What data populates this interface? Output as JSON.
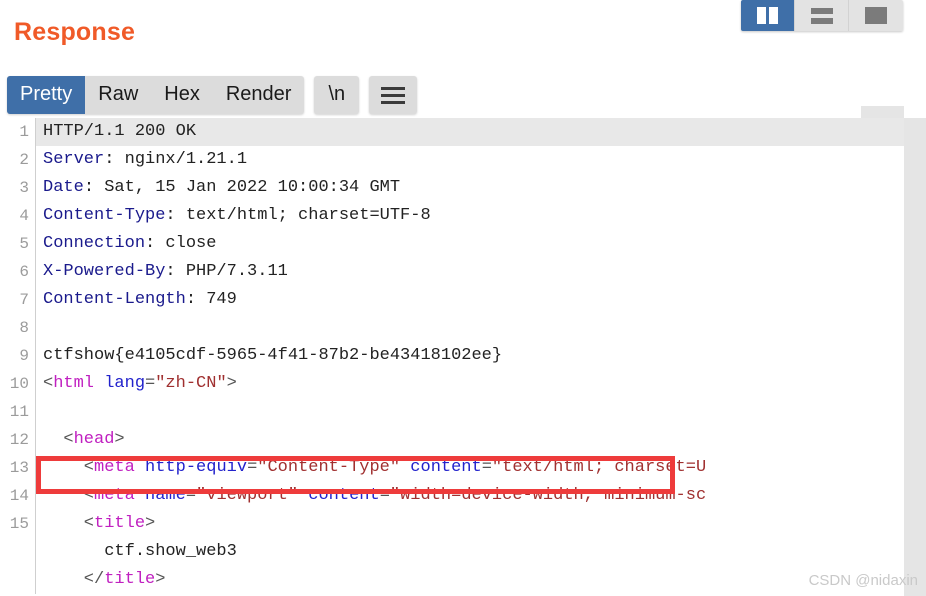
{
  "panel": {
    "title": "Response"
  },
  "layout_toggles": [
    {
      "name": "split-vertical",
      "label": "",
      "active": true
    },
    {
      "name": "split-horizontal",
      "label": "",
      "active": false
    },
    {
      "name": "single-pane",
      "label": "",
      "active": false
    }
  ],
  "tabs": [
    {
      "label": "Pretty",
      "active": true
    },
    {
      "label": "Raw",
      "active": false
    },
    {
      "label": "Hex",
      "active": false
    },
    {
      "label": "Render",
      "active": false
    }
  ],
  "toolbar": {
    "newline_label": "\\n",
    "menu_icon": "hamburger-menu-icon"
  },
  "highlight": {
    "color": "#ee3b3b",
    "flag_text": "ctfshow{e4105cdf-5965-4f41-87b2-be43418102ee}"
  },
  "colors": {
    "accent_title": "#f05a28",
    "active_tab": "#3f6fa8",
    "header_name": "#1a1a8c",
    "tag": "#c020c0",
    "attr": "#2222cc",
    "value": "#a03030"
  },
  "watermark": "CSDN @nidaxin",
  "code": {
    "lines": [
      {
        "num": "1",
        "highlight": true,
        "segments": [
          {
            "cls": "plain",
            "t": "HTTP/1.1 200 OK"
          }
        ]
      },
      {
        "num": "2",
        "highlight": false,
        "segments": [
          {
            "cls": "hdr",
            "t": "Server"
          },
          {
            "cls": "plain",
            "t": ": nginx/1.21.1"
          }
        ]
      },
      {
        "num": "3",
        "highlight": false,
        "segments": [
          {
            "cls": "hdr",
            "t": "Date"
          },
          {
            "cls": "plain",
            "t": ": Sat, 15 Jan 2022 10:00:34 GMT"
          }
        ]
      },
      {
        "num": "4",
        "highlight": false,
        "segments": [
          {
            "cls": "hdr",
            "t": "Content-Type"
          },
          {
            "cls": "plain",
            "t": ": text/html; charset=UTF-8"
          }
        ]
      },
      {
        "num": "5",
        "highlight": false,
        "segments": [
          {
            "cls": "hdr",
            "t": "Connection"
          },
          {
            "cls": "plain",
            "t": ": close"
          }
        ]
      },
      {
        "num": "6",
        "highlight": false,
        "segments": [
          {
            "cls": "hdr",
            "t": "X-Powered-By"
          },
          {
            "cls": "plain",
            "t": ": PHP/7.3.11"
          }
        ]
      },
      {
        "num": "7",
        "highlight": false,
        "segments": [
          {
            "cls": "hdr",
            "t": "Content-Length"
          },
          {
            "cls": "plain",
            "t": ": 749"
          }
        ]
      },
      {
        "num": "8",
        "highlight": false,
        "segments": []
      },
      {
        "num": "9",
        "highlight": false,
        "segments": [
          {
            "cls": "plain",
            "t": "ctfshow{e4105cdf-5965-4f41-87b2-be43418102ee}"
          }
        ]
      },
      {
        "num": "10",
        "highlight": false,
        "segments": [
          {
            "cls": "punc",
            "t": "<"
          },
          {
            "cls": "tag",
            "t": "html"
          },
          {
            "cls": "punc",
            "t": " "
          },
          {
            "cls": "attr",
            "t": "lang"
          },
          {
            "cls": "punc",
            "t": "="
          },
          {
            "cls": "val",
            "t": "\"zh-CN\""
          },
          {
            "cls": "punc",
            "t": ">"
          }
        ]
      },
      {
        "num": "11",
        "highlight": false,
        "segments": []
      },
      {
        "num": "12",
        "highlight": false,
        "segments": [
          {
            "cls": "punc",
            "t": "  <"
          },
          {
            "cls": "tag",
            "t": "head"
          },
          {
            "cls": "punc",
            "t": ">"
          }
        ]
      },
      {
        "num": "13",
        "highlight": false,
        "segments": [
          {
            "cls": "punc",
            "t": "    <"
          },
          {
            "cls": "tag",
            "t": "meta"
          },
          {
            "cls": "punc",
            "t": " "
          },
          {
            "cls": "attr",
            "t": "http-equiv"
          },
          {
            "cls": "punc",
            "t": "="
          },
          {
            "cls": "val",
            "t": "\"Content-Type\""
          },
          {
            "cls": "punc",
            "t": " "
          },
          {
            "cls": "attr",
            "t": "content"
          },
          {
            "cls": "punc",
            "t": "="
          },
          {
            "cls": "val",
            "t": "\"text/html; charset=U"
          }
        ]
      },
      {
        "num": "14",
        "highlight": false,
        "segments": [
          {
            "cls": "punc",
            "t": "    <"
          },
          {
            "cls": "tag",
            "t": "meta"
          },
          {
            "cls": "punc",
            "t": " "
          },
          {
            "cls": "attr",
            "t": "name"
          },
          {
            "cls": "punc",
            "t": "="
          },
          {
            "cls": "val",
            "t": "\"viewport\""
          },
          {
            "cls": "punc",
            "t": " "
          },
          {
            "cls": "attr",
            "t": "content"
          },
          {
            "cls": "punc",
            "t": "="
          },
          {
            "cls": "val",
            "t": "\"width=device-width, minimum-sc"
          }
        ]
      },
      {
        "num": "15",
        "highlight": false,
        "segments": [
          {
            "cls": "punc",
            "t": "    <"
          },
          {
            "cls": "tag",
            "t": "title"
          },
          {
            "cls": "punc",
            "t": ">"
          }
        ]
      },
      {
        "num": "",
        "highlight": false,
        "segments": [
          {
            "cls": "plain",
            "t": "      ctf.show_web3"
          }
        ]
      },
      {
        "num": "",
        "highlight": false,
        "segments": [
          {
            "cls": "punc",
            "t": "    </"
          },
          {
            "cls": "tag",
            "t": "title"
          },
          {
            "cls": "punc",
            "t": ">"
          }
        ]
      }
    ]
  }
}
